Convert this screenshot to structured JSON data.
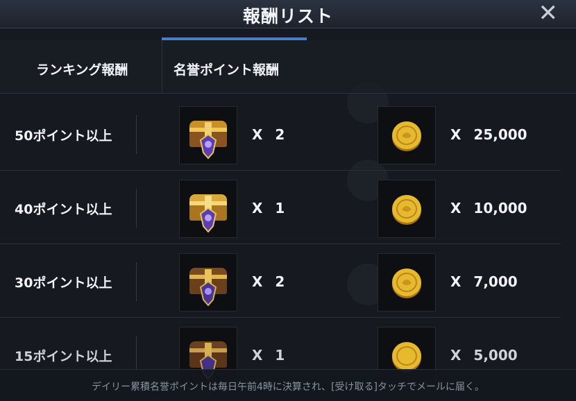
{
  "header": {
    "title": "報酬リスト",
    "close_icon": "close-icon"
  },
  "tabs": [
    {
      "label": "ランキング報酬",
      "active": false
    },
    {
      "label": "名誉ポイント報酬",
      "active": true
    }
  ],
  "rewards": [
    {
      "label": "50ポイント以上",
      "chest_qty_prefix": "X",
      "chest_qty": "2",
      "coin_qty_prefix": "X",
      "coin_qty": "25,000"
    },
    {
      "label": "40ポイント以上",
      "chest_qty_prefix": "X",
      "chest_qty": "1",
      "coin_qty_prefix": "X",
      "coin_qty": "10,000"
    },
    {
      "label": "30ポイント以上",
      "chest_qty_prefix": "X",
      "chest_qty": "2",
      "coin_qty_prefix": "X",
      "coin_qty": "7,000"
    },
    {
      "label": "15ポイント以上",
      "chest_qty_prefix": "X",
      "chest_qty": "1",
      "coin_qty_prefix": "X",
      "coin_qty": "5,000"
    }
  ],
  "footer": {
    "text": "デイリー累積名誉ポイントは毎日午前4時に決算され、[受け取る]タッチでメールに届く。"
  },
  "colors": {
    "accent_tab": "#4a7fc8",
    "chest_gold": "#d8a93a",
    "chest_wood": "#6a3f1c",
    "crest_purple": "#5b3fb0",
    "coin_gold": "#e7b92e"
  },
  "icons": {
    "chest": "treasure-chest-icon",
    "coin": "gold-coin-icon"
  }
}
